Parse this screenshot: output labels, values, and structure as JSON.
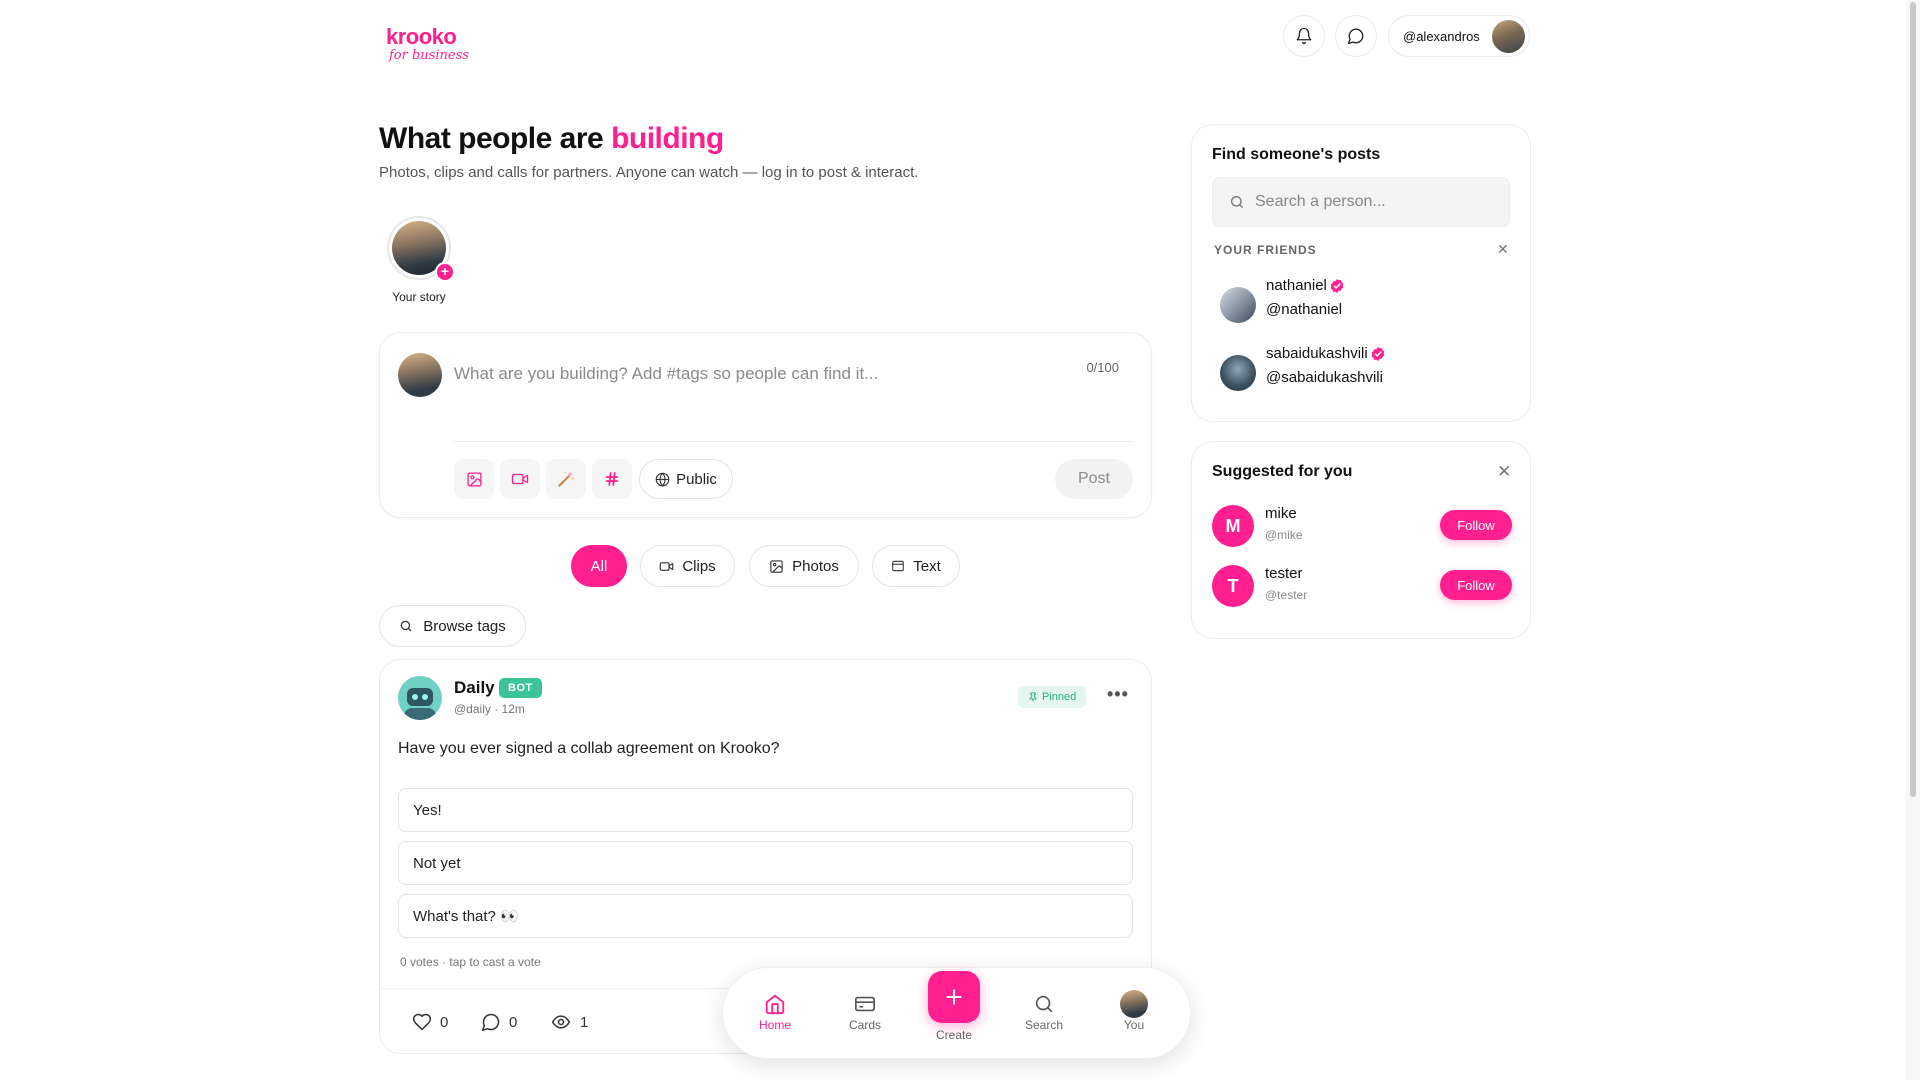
{
  "header": {
    "logo_main": "krooko",
    "logo_sub": "for business",
    "username": "@alexandros"
  },
  "page": {
    "title_prefix": "What people are",
    "title_highlight": "building",
    "subtitle": "Photos, clips and calls for partners. Anyone can watch — log in to post & interact."
  },
  "story": {
    "label": "Your story"
  },
  "composer": {
    "placeholder": "What are you building? Add #tags so people can find it...",
    "counter": "0/100",
    "visibility": "Public",
    "post_label": "Post"
  },
  "filters": [
    {
      "label": "All",
      "active": true
    },
    {
      "label": "Clips"
    },
    {
      "label": "Photos"
    },
    {
      "label": "Text"
    }
  ],
  "browse_tags": "Browse tags",
  "post": {
    "author": "Daily",
    "badge": "BOT",
    "meta": "@daily · 12m",
    "pinned": "Pinned",
    "question": "Have you ever signed a collab agreement on Krooko?",
    "options": [
      "Yes!",
      "Not yet",
      "What's that? 👀"
    ],
    "votes_text": "0 votes · tap to cast a vote",
    "likes": "0",
    "comments": "0",
    "views": "1"
  },
  "find_panel": {
    "title": "Find someone's posts",
    "search_placeholder": "Search a person...",
    "friends_label": "YOUR FRIENDS",
    "friends": [
      {
        "name": "nathaniel",
        "handle": "@nathaniel"
      },
      {
        "name": "sabaidukashvili",
        "handle": "@sabaidukashvili"
      }
    ]
  },
  "suggested_panel": {
    "title": "Suggested for you",
    "users": [
      {
        "initial": "M",
        "name": "mike",
        "handle": "@mike",
        "button": "Follow"
      },
      {
        "initial": "T",
        "name": "tester",
        "handle": "@tester",
        "button": "Follow"
      }
    ]
  },
  "bottom_nav": {
    "home": "Home",
    "cards": "Cards",
    "create": "Create",
    "search": "Search",
    "you": "You"
  },
  "colors": {
    "accent": "#ff1f8e",
    "bot_badge": "#3bc49a",
    "pinned_bg": "#e3f6ef"
  },
  "icons": [
    "bell-icon",
    "chat-icon",
    "image-icon",
    "video-icon",
    "magic-wand-icon",
    "hashtag-icon",
    "globe-icon",
    "search-icon",
    "heart-icon",
    "comment-icon",
    "eye-icon",
    "pin-icon",
    "close-icon",
    "verified-icon",
    "home-icon",
    "cards-icon",
    "plus-icon"
  ]
}
